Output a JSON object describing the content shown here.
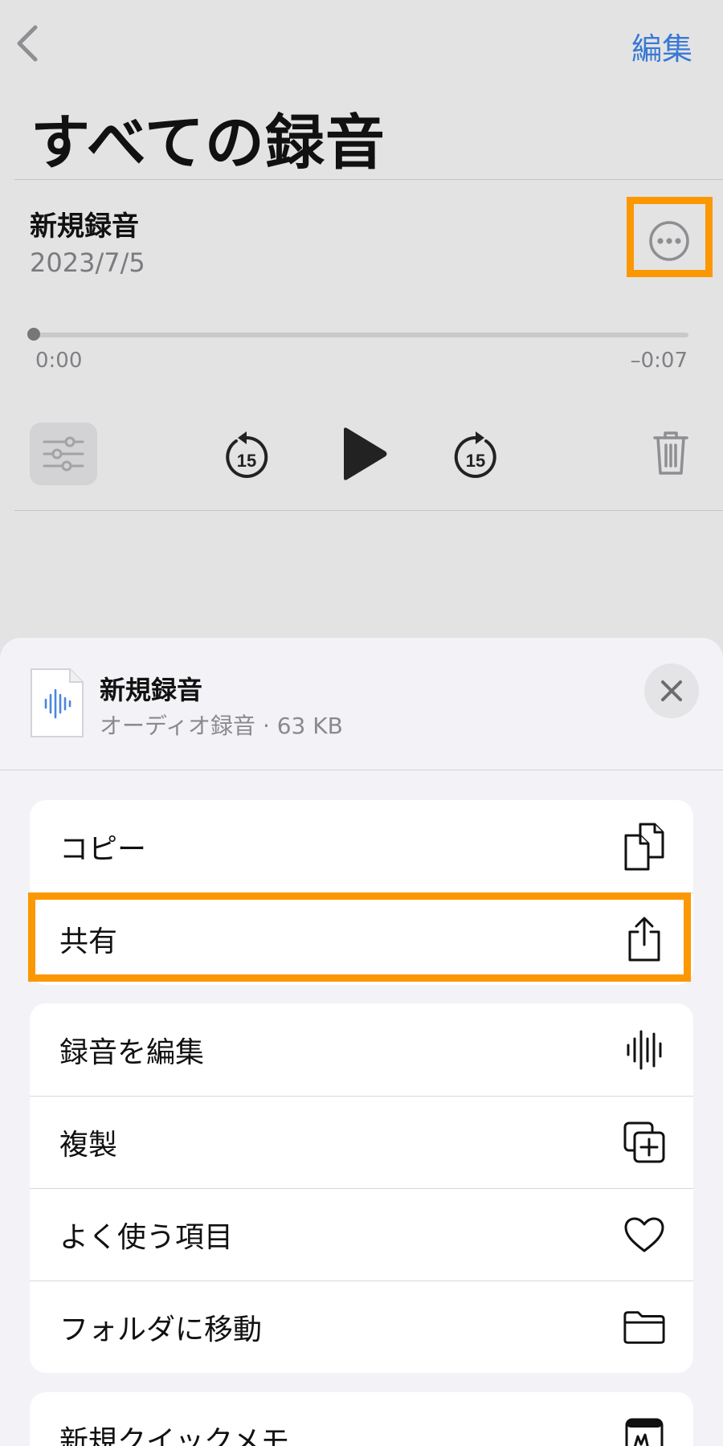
{
  "nav": {
    "edit_label": "編集"
  },
  "page": {
    "title": "すべての録音"
  },
  "recording": {
    "name": "新規録音",
    "date": "2023/7/5",
    "time_start": "0:00",
    "time_end": "–0:07",
    "skip_back_seconds": "15",
    "skip_forward_seconds": "15",
    "progress": 0
  },
  "sheet": {
    "title": "新規録音",
    "subtitle": "オーディオ録音 · 63 KB",
    "groups": [
      {
        "items": [
          {
            "label": "コピー",
            "icon": "copy-icon"
          },
          {
            "label": "共有",
            "icon": "share-icon"
          }
        ]
      },
      {
        "items": [
          {
            "label": "録音を編集",
            "icon": "waveform-icon"
          },
          {
            "label": "複製",
            "icon": "duplicate-icon"
          },
          {
            "label": "よく使う項目",
            "icon": "heart-icon"
          },
          {
            "label": "フォルダに移動",
            "icon": "folder-icon"
          }
        ]
      },
      {
        "items": [
          {
            "label": "新規クイックメモ",
            "icon": "quick-note-icon"
          }
        ]
      }
    ]
  },
  "colors": {
    "accent": "#3a78d4",
    "highlight": "#fb9700",
    "background": "#e3e3e4",
    "sheet": "#f2f2f7"
  }
}
